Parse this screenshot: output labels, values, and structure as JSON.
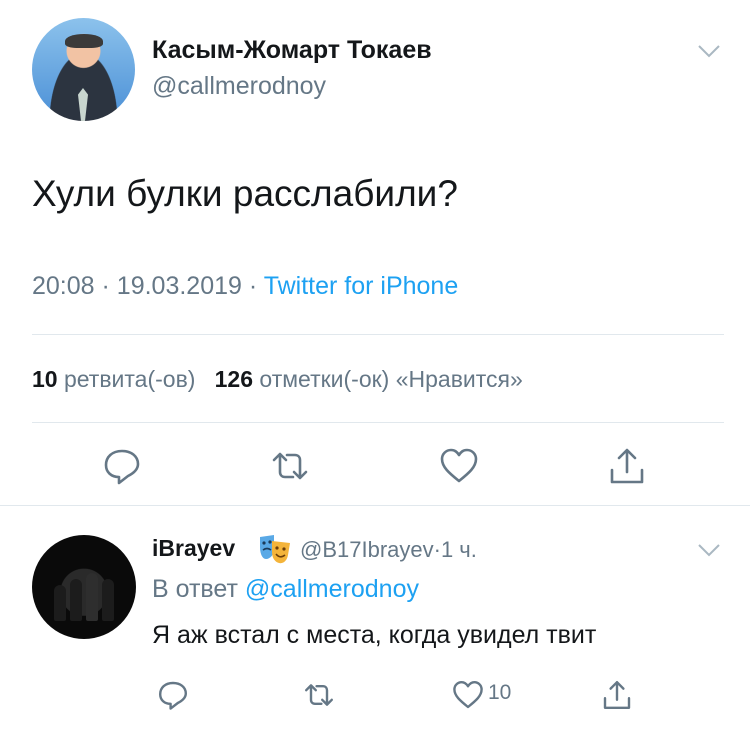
{
  "tweet": {
    "author_name": "Касым-Жомарт Токаев",
    "author_handle": "@callmerodnoy",
    "text": "Хули булки расслабили?",
    "time": "20:08",
    "date": "19.03.2019",
    "source": "Twitter for iPhone",
    "retweet_count": "10",
    "retweet_label": "ретвита(-ов)",
    "like_count": "126",
    "like_label": "отметки(-ок) «Нравится»",
    "separator": "·"
  },
  "actions": [
    "reply-icon",
    "retweet-icon",
    "like-icon",
    "share-icon"
  ],
  "reply": {
    "author_name": "iBrayev",
    "author_emoji": "theater-masks-emoji",
    "author_handle": "@B17Ibrayev",
    "age": "1 ч.",
    "reply_prefix": "В ответ",
    "reply_mention": "@callmerodnoy",
    "text": "Я аж встал с места, когда увидел твит",
    "like_count": "10"
  },
  "colors": {
    "text": "#14171a",
    "secondary": "#657786",
    "link": "#1da1f2",
    "separator": "#e1e8ed"
  }
}
